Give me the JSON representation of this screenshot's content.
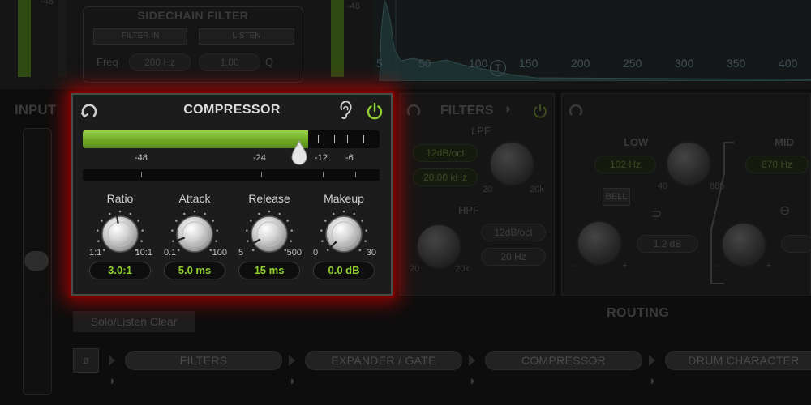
{
  "sidechain": {
    "title": "SIDECHAIN FILTER",
    "filter_in": "FILTER IN",
    "listen": "LISTEN",
    "freq_label": "Freq",
    "freq_value": "200 Hz",
    "q_value": "1.00",
    "q_label": "Q",
    "top_meter_label": "-48"
  },
  "spectrum": {
    "left_label": "-48",
    "freq_labels": [
      "5",
      "50",
      "100",
      "150",
      "200",
      "250",
      "300",
      "350",
      "400"
    ],
    "marker": "T"
  },
  "input": {
    "title": "INPUT"
  },
  "compressor": {
    "title": "COMPRESSOR",
    "accent": "#8fcf2e",
    "gain_reduction_fraction": 0.76,
    "threshold_scale": [
      "-48",
      "-24",
      "-12",
      "-6"
    ],
    "knobs": [
      {
        "name": "Ratio",
        "min": "1:1",
        "max": "10:1",
        "value": "3.0:1"
      },
      {
        "name": "Attack",
        "min": "0.1",
        "max": "100",
        "value": "5.0 ms"
      },
      {
        "name": "Release",
        "min": "5",
        "max": "500",
        "value": "15 ms"
      },
      {
        "name": "Makeup",
        "min": "0",
        "max": "30",
        "value": "0.0 dB"
      }
    ]
  },
  "filters": {
    "title": "FILTERS",
    "lpf": {
      "label": "LPF",
      "slope": "12dB/oct",
      "freq": "20.00 kHz",
      "min": "20",
      "max": "20k"
    },
    "hpf": {
      "label": "HPF",
      "slope": "12dB/oct",
      "freq": "20 Hz",
      "min": "20",
      "max": "20k"
    }
  },
  "eq": {
    "low": {
      "label": "LOW",
      "freq": "102 Hz",
      "min": "40",
      "max": "885",
      "bell": "BELL",
      "gain": "1.2 dB"
    },
    "mid": {
      "label": "MID",
      "freq": "870 Hz"
    }
  },
  "routing": {
    "solo_clear": "Solo/Listen Clear",
    "title": "ROUTING",
    "phase": "ø",
    "chain": [
      "FILTERS",
      "EXPANDER / GATE",
      "COMPRESSOR",
      "DRUM CHARACTER"
    ]
  }
}
